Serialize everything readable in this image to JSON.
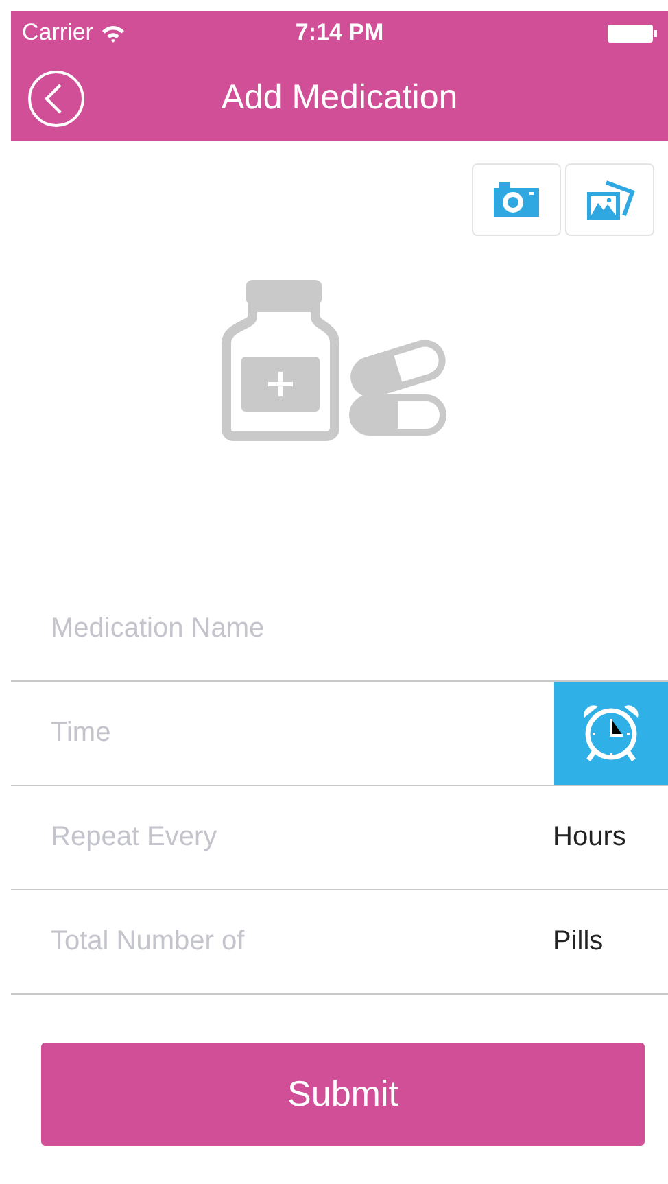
{
  "status_bar": {
    "carrier": "Carrier",
    "time": "7:14 PM"
  },
  "nav_bar": {
    "title": "Add Medication"
  },
  "form": {
    "fields": [
      {
        "kind": "plain",
        "placeholder": "Medication Name"
      },
      {
        "kind": "alarm",
        "placeholder": "Time"
      },
      {
        "kind": "unit",
        "placeholder": "Repeat Every",
        "unit": "Hours"
      },
      {
        "kind": "unit",
        "placeholder": "Total Number of",
        "unit": "Pills"
      }
    ]
  },
  "submit_button": {
    "label": "Submit"
  }
}
